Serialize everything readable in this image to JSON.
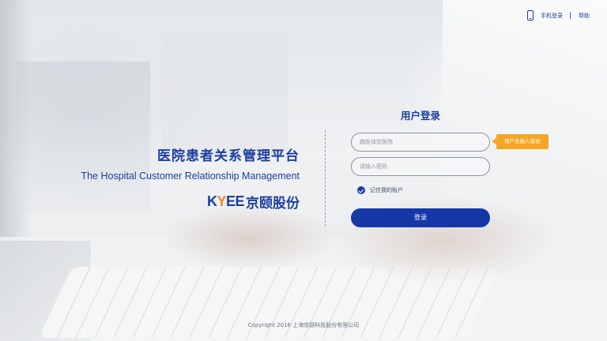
{
  "topbar": {
    "mobile_login": "手机登录",
    "help": "帮助",
    "icons": {
      "mobile": "mobile-phone-icon"
    }
  },
  "brand": {
    "title_cn": "医院患者关系管理平台",
    "title_en": "The Hospital Customer Relationship Management",
    "logo_latin_k": "K",
    "logo_latin_y": "Y",
    "logo_latin_ee": "EE",
    "logo_cn": "京颐股份"
  },
  "login": {
    "title": "用户登录",
    "username_value": "",
    "username_placeholder": "趣医体验医院",
    "password_value": "",
    "password_placeholder": "请输入密码",
    "error_tip": "用户名输入错误",
    "remember_label": "记住我的账户",
    "remember_checked": true,
    "submit_label": "登录"
  },
  "footer": {
    "copyright": "Copyright 2016 上海京颐科技股份有限公司"
  },
  "colors": {
    "primary": "#1b3ea0",
    "button": "#1537a8",
    "warning": "#f5a623",
    "logo_accent": "#f18b1c"
  }
}
